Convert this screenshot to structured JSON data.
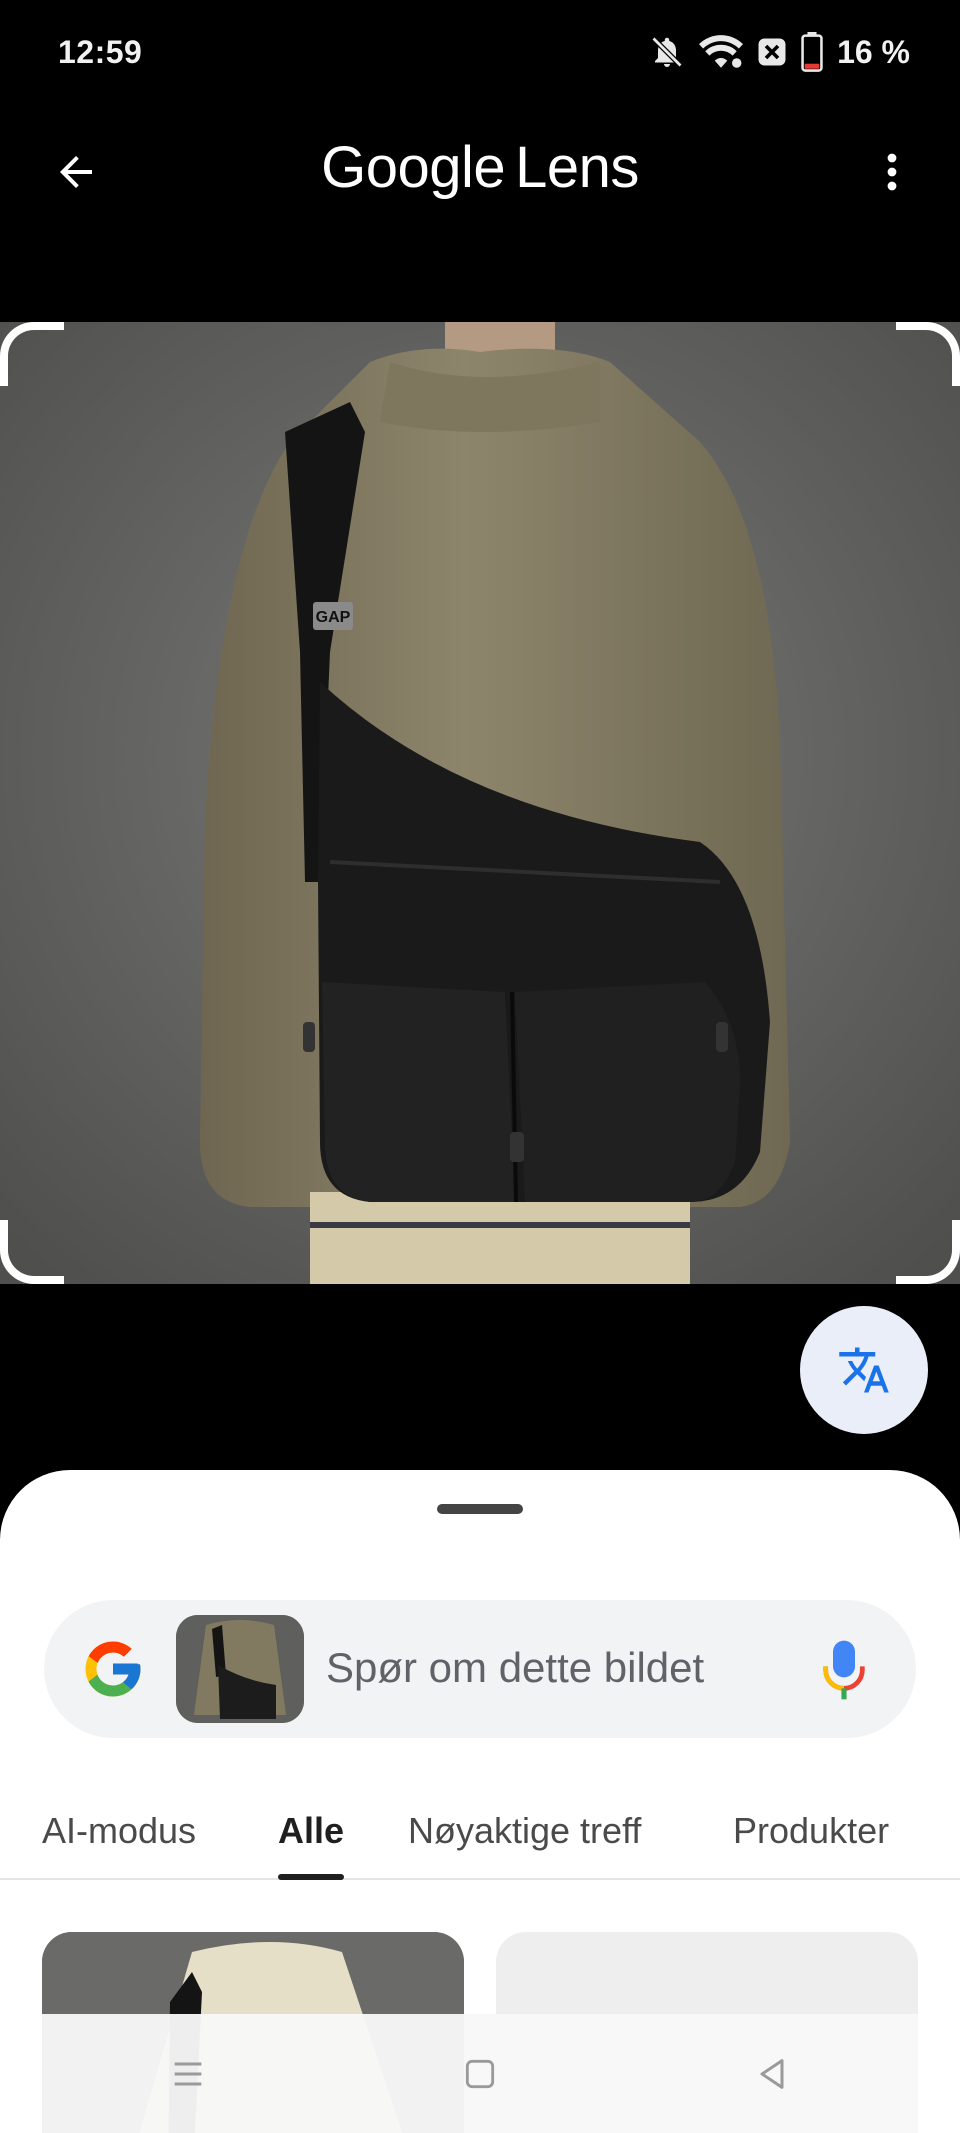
{
  "status_bar": {
    "time": "12:59",
    "battery_pct": "16 %",
    "icons": [
      "bell-off-icon",
      "wifi-icon",
      "close-box-icon",
      "battery-icon"
    ],
    "battery_level": 0.16,
    "battery_color": "#e53935"
  },
  "app_bar": {
    "title_brand": "Google",
    "title_sub": "Lens",
    "back_icon": "arrow-back-icon",
    "more_icon": "more-vert-icon"
  },
  "image_viewer": {
    "badge_text": "GAP",
    "translate_icon": "translate-icon"
  },
  "sheet": {
    "search_placeholder": "Spør om dette bildet",
    "google_icon": "google-g-icon",
    "mic_icon": "mic-icon"
  },
  "tabs": [
    {
      "label": "AI-modus",
      "active": false
    },
    {
      "label": "Alle",
      "active": true
    },
    {
      "label": "Nøyaktige treff",
      "active": false
    },
    {
      "label": "Produkter",
      "active": false
    }
  ],
  "nav": {
    "icons": [
      "menu-icon",
      "home-square-icon",
      "back-triangle-icon"
    ]
  },
  "colors": {
    "accent_blue": "#1a73e8",
    "fab_bg": "#e9eef8",
    "sheet_bg": "#ffffff",
    "search_bg": "#f1f3f4"
  }
}
